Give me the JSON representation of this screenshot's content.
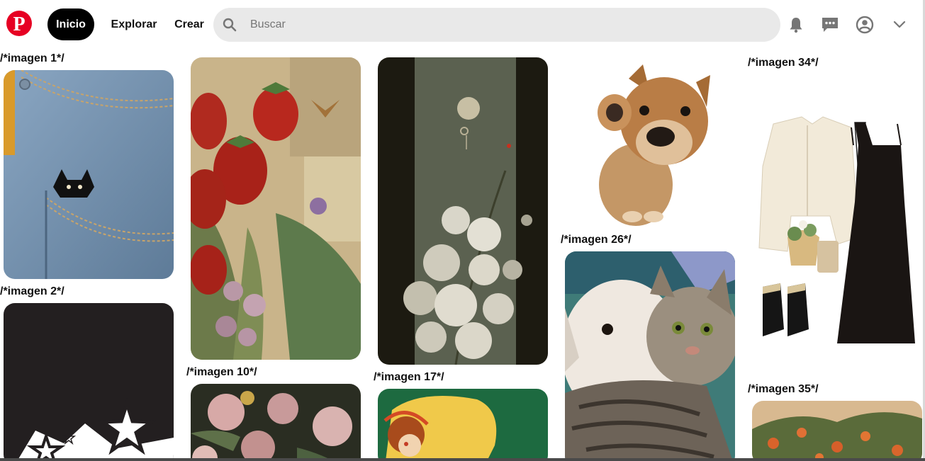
{
  "header": {
    "logo_icon": "pinterest-logo",
    "brand_color": "#e60023",
    "nav": {
      "inicio": "Inicio",
      "explorar": "Explorar",
      "crear": "Crear"
    },
    "search": {
      "placeholder": "Buscar",
      "value": ""
    },
    "icons": [
      "bell-icon",
      "chat-icon",
      "profile-icon",
      "chevron-down-icon"
    ]
  },
  "captions": {
    "imagen_1": "/*imagen 1*/",
    "imagen_2": "/*imagen 2*/",
    "imagen_10": "/*imagen 10*/",
    "imagen_17": "/*imagen 17*/",
    "imagen_26": "/*imagen 26*/",
    "imagen_34": "/*imagen 34*/",
    "imagen_35": "/*imagen 35*/"
  }
}
